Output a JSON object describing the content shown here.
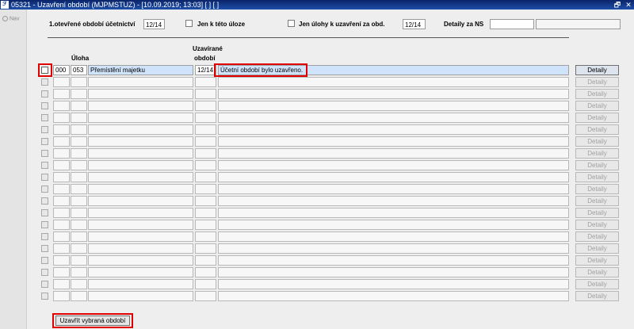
{
  "window": {
    "title": "05321 - Uzavření období (MJPMSTUZ) - [10.09.2019; 13:03]  [ ]  [ ]",
    "app_icon": "app-logo-icon",
    "restore_glyph": "🗗",
    "close_glyph": "✕"
  },
  "nav": {
    "label": "Nav"
  },
  "filters": {
    "period_label": "1.otevřené období účetnictví",
    "period_value": "12/14",
    "only_task_label": "Jen k této úloze",
    "only_close_label": "Jen úlohy k uzavření za obd.",
    "close_period_value": "12/14",
    "details_ns_label": "Detaily za NS",
    "details_ns_value": "",
    "details_ns_value2": ""
  },
  "table": {
    "headers": {
      "task": "Úloha",
      "closing_period_line1": "Uzavírané",
      "closing_period_line2": "období"
    },
    "rows": [
      {
        "code1": "000",
        "code2": "053",
        "name": "Přemístění majetku",
        "period": "12/14",
        "message": "Účetní období bylo uzavřeno.",
        "details": "Detaily"
      },
      {
        "code1": "",
        "code2": "",
        "name": "",
        "period": "",
        "message": "",
        "details": "Detaily"
      },
      {
        "code1": "",
        "code2": "",
        "name": "",
        "period": "",
        "message": "",
        "details": "Detaily"
      },
      {
        "code1": "",
        "code2": "",
        "name": "",
        "period": "",
        "message": "",
        "details": "Detaily"
      },
      {
        "code1": "",
        "code2": "",
        "name": "",
        "period": "",
        "message": "",
        "details": "Detaily"
      },
      {
        "code1": "",
        "code2": "",
        "name": "",
        "period": "",
        "message": "",
        "details": "Detaily"
      },
      {
        "code1": "",
        "code2": "",
        "name": "",
        "period": "",
        "message": "",
        "details": "Detaily"
      },
      {
        "code1": "",
        "code2": "",
        "name": "",
        "period": "",
        "message": "",
        "details": "Detaily"
      },
      {
        "code1": "",
        "code2": "",
        "name": "",
        "period": "",
        "message": "",
        "details": "Detaily"
      },
      {
        "code1": "",
        "code2": "",
        "name": "",
        "period": "",
        "message": "",
        "details": "Detaily"
      },
      {
        "code1": "",
        "code2": "",
        "name": "",
        "period": "",
        "message": "",
        "details": "Detaily"
      },
      {
        "code1": "",
        "code2": "",
        "name": "",
        "period": "",
        "message": "",
        "details": "Detaily"
      },
      {
        "code1": "",
        "code2": "",
        "name": "",
        "period": "",
        "message": "",
        "details": "Detaily"
      },
      {
        "code1": "",
        "code2": "",
        "name": "",
        "period": "",
        "message": "",
        "details": "Detaily"
      },
      {
        "code1": "",
        "code2": "",
        "name": "",
        "period": "",
        "message": "",
        "details": "Detaily"
      },
      {
        "code1": "",
        "code2": "",
        "name": "",
        "period": "",
        "message": "",
        "details": "Detaily"
      },
      {
        "code1": "",
        "code2": "",
        "name": "",
        "period": "",
        "message": "",
        "details": "Detaily"
      },
      {
        "code1": "",
        "code2": "",
        "name": "",
        "period": "",
        "message": "",
        "details": "Detaily"
      },
      {
        "code1": "",
        "code2": "",
        "name": "",
        "period": "",
        "message": "",
        "details": "Detaily"
      },
      {
        "code1": "",
        "code2": "",
        "name": "",
        "period": "",
        "message": "",
        "details": "Detaily"
      }
    ]
  },
  "actions": {
    "close_selected_label": "Uzavřít vybraná období"
  },
  "colors": {
    "highlight": "#e00000",
    "titlebar": "#0a246a",
    "selected_row": "#cfe3fb"
  }
}
